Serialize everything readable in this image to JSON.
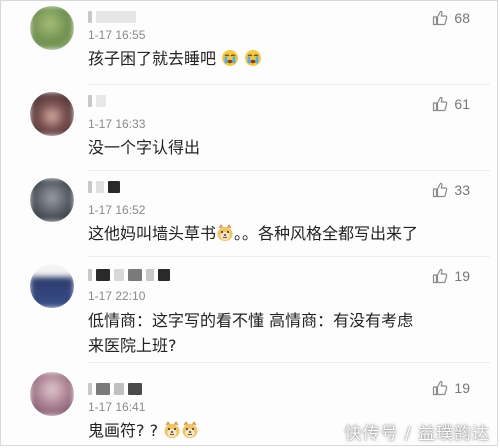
{
  "comments": [
    {
      "time": "1-17 16:55",
      "text": "孩子困了就去睡吧",
      "emojis": [
        "crying-face",
        "crying-face"
      ],
      "likes": "68",
      "avatar_color": "#7d9a5c"
    },
    {
      "time": "1-17 16:33",
      "text": "没一个字认得出",
      "emojis": [],
      "likes": "61",
      "avatar_color": "#6a4a4a"
    },
    {
      "time": "1-17 16:52",
      "text_before": "这他妈叫墙头草书",
      "text_after": "。。各种风格全都写出来了",
      "emojis": [
        "doge-face"
      ],
      "likes": "33",
      "avatar_color": "#555a60"
    },
    {
      "time": "1-17 22:10",
      "text": "低情商：这字写的看不懂 高情商：有没有考虑来医院上班?",
      "emojis": [],
      "likes": "19",
      "avatar_color": "#3a4a7a"
    },
    {
      "time": "1-17 16:41",
      "text": "鬼画符? ?",
      "emojis": [
        "doge-face",
        "doge-face"
      ],
      "likes": "19",
      "avatar_color": "#9a7a8a"
    }
  ],
  "watermark": "快传号 / 益璞韵达",
  "colors": {
    "like_icon": "#8a8a8a",
    "time": "#8a8a8a",
    "text": "#222222"
  }
}
